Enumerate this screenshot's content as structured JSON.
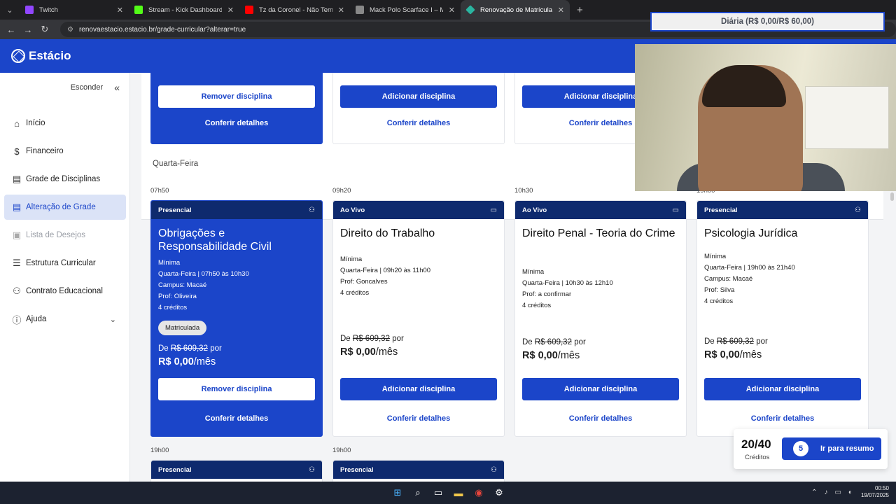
{
  "browser": {
    "tabs": [
      {
        "title": "Twitch",
        "color": "#9146ff"
      },
      {
        "title": "Stream - Kick Dashboard",
        "color": "#53fc18"
      },
      {
        "title": "Tz da Coronel - Não Temos Me",
        "color": "#ff0000"
      },
      {
        "title": "Mack Polo Scarface I – Mack D",
        "color": "#888888"
      },
      {
        "title": "Renovação de Matrícula Estácio",
        "color": "#2ab5a0"
      }
    ],
    "url": "renovaestacio.estacio.br/grade-curricular?alterar=true"
  },
  "app": {
    "logo": "Estácio",
    "brand_color": "#1b45c9"
  },
  "sidebar": {
    "hide_label": "Esconder",
    "items": [
      {
        "label": "Início",
        "icon": "home-icon"
      },
      {
        "label": "Financeiro",
        "icon": "dollar-icon"
      },
      {
        "label": "Grade de Disciplinas",
        "icon": "document-icon"
      },
      {
        "label": "Alteração de Grade",
        "icon": "document-icon"
      },
      {
        "label": "Lista de Desejos",
        "icon": "gift-icon"
      },
      {
        "label": "Estrutura Curricular",
        "icon": "list-icon"
      },
      {
        "label": "Contrato Educacional",
        "icon": "user-check-icon"
      },
      {
        "label": "Ajuda",
        "icon": "info-icon"
      }
    ]
  },
  "top_cards": [
    {
      "primary": "Remover disciplina",
      "link": "Conferir detalhes"
    },
    {
      "primary": "Adicionar disciplina",
      "link": "Conferir detalhes"
    },
    {
      "primary": "Adicionar disciplina",
      "link": "Conferir detalhes"
    }
  ],
  "day": {
    "title": "Quarta-Feira",
    "times": [
      "07h50",
      "09h20",
      "10h30",
      "19h00"
    ],
    "evening_times": [
      "19h00",
      "19h00"
    ],
    "cards": [
      {
        "mode": "Presencial",
        "title": "Obrigações e Responsabilidade Civil",
        "info": [
          "Mínima",
          "Quarta-Feira | 07h50 às 10h30",
          "Campus: Macaé",
          "Prof: Oliveira",
          "4 créditos"
        ],
        "badge": "Matriculada",
        "price_from": "De",
        "price_old": "R$ 609,32",
        "price_per": "por",
        "price_new": "R$ 0,00",
        "price_unit": "/mês",
        "primary": "Remover disciplina",
        "link": "Conferir detalhes"
      },
      {
        "mode": "Ao Vivo",
        "title": "Direito do Trabalho",
        "info": [
          "Mínima",
          "Quarta-Feira | 09h20 às 11h00",
          "Prof: Goncalves",
          "4 créditos"
        ],
        "price_from": "De",
        "price_old": "R$ 609,32",
        "price_per": "por",
        "price_new": "R$ 0,00",
        "price_unit": "/mês",
        "primary": "Adicionar disciplina",
        "link": "Conferir detalhes"
      },
      {
        "mode": "Ao Vivo",
        "title": "Direito Penal - Teoria do Crime",
        "info": [
          "Mínima",
          "Quarta-Feira | 10h30 às 12h10",
          "Prof: a confirmar",
          "4 créditos"
        ],
        "price_from": "De",
        "price_old": "R$ 609,32",
        "price_per": "por",
        "price_new": "R$ 0,00",
        "price_unit": "/mês",
        "primary": "Adicionar disciplina",
        "link": "Conferir detalhes"
      },
      {
        "mode": "Presencial",
        "title": "Psicologia Jurídica",
        "info": [
          "Mínima",
          "Quarta-Feira | 19h00 às 21h40",
          "Campus: Macaé",
          "Prof: Silva",
          "4 créditos"
        ],
        "price_from": "De",
        "price_old": "R$ 609,32",
        "price_per": "por",
        "price_new": "R$ 0,00",
        "price_unit": "/mês",
        "primary": "Adicionar disciplina",
        "link": "Conferir detalhes"
      }
    ],
    "evening_cards": [
      {
        "mode": "Presencial"
      },
      {
        "mode": "Presencial"
      }
    ]
  },
  "overlay": {
    "daily_price": "Diária (R$ 0,00/R$ 60,00)"
  },
  "credits": {
    "value": "20/40",
    "label": "Créditos",
    "count": "5",
    "button": "Ir para resumo"
  },
  "taskbar": {
    "time": "00:50",
    "date": "19/07/2025"
  }
}
